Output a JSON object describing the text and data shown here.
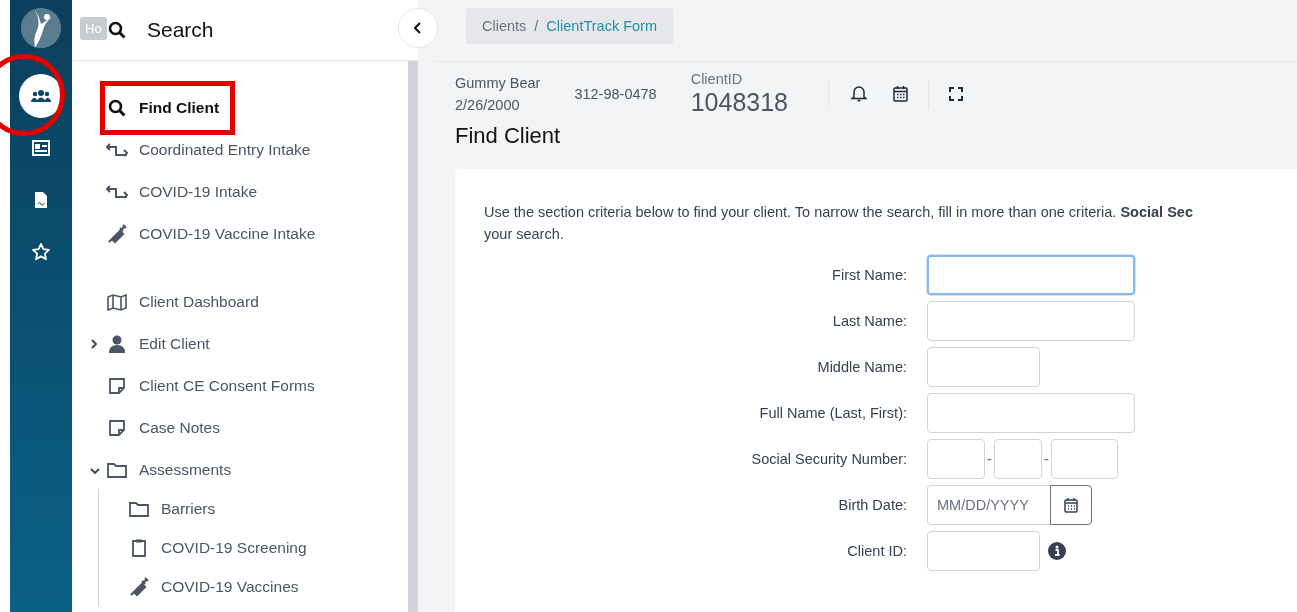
{
  "rail": {
    "tooltip": "Ho",
    "items": [
      {
        "kind": "people",
        "selected": true,
        "annotated": true
      },
      {
        "kind": "card",
        "selected": false,
        "annotated": false
      },
      {
        "kind": "document",
        "selected": false,
        "annotated": false
      },
      {
        "kind": "star",
        "selected": false,
        "annotated": false
      }
    ]
  },
  "sidebar": {
    "title": "Search",
    "sections": [
      {
        "items": [
          {
            "label": "Find Client",
            "kind": "search",
            "selected": true,
            "annotated": true
          },
          {
            "label": "Coordinated Entry Intake",
            "kind": "swap",
            "selected": false,
            "annotated": false
          },
          {
            "label": "COVID-19 Intake",
            "kind": "swap",
            "selected": false,
            "annotated": false
          },
          {
            "label": "COVID-19 Vaccine Intake",
            "kind": "syringe",
            "selected": false,
            "annotated": false
          }
        ]
      },
      {
        "items": [
          {
            "label": "Client Dashboard",
            "kind": "map",
            "selected": false,
            "annotated": false
          },
          {
            "label": "Edit Client",
            "kind": "person",
            "selected": false,
            "annotated": false,
            "expanded": false
          },
          {
            "label": "Client CE Consent Forms",
            "kind": "note",
            "selected": false,
            "annotated": false
          },
          {
            "label": "Case Notes",
            "kind": "note",
            "selected": false,
            "annotated": false
          },
          {
            "label": "Assessments",
            "kind": "folder",
            "selected": false,
            "annotated": false,
            "expanded": true,
            "children": [
              {
                "label": "Barriers",
                "kind": "folder",
                "selected": false,
                "annotated": false
              },
              {
                "label": "COVID-19 Screening",
                "kind": "clipboard",
                "selected": false,
                "annotated": false
              },
              {
                "label": "COVID-19 Vaccines",
                "kind": "syringe",
                "selected": false,
                "annotated": false
              }
            ]
          }
        ]
      }
    ]
  },
  "breadcrumb": {
    "items": [
      "Clients",
      "ClientTrack Form"
    ],
    "separator": "/"
  },
  "client": {
    "name": "Gummy Bear",
    "birth_date": "2/26/2000",
    "ssn": "312-98-0478",
    "id_label": "ClientID",
    "id": "1048318"
  },
  "page_title": "Find Client",
  "intro": [
    "Use the section criteria below to find your client. To narrow the search, fill in more than one criteria. **Social Sec**",
    "your search."
  ],
  "fields": [
    {
      "label": "First Name:",
      "kind": "wide",
      "focused": true
    },
    {
      "label": "Last Name:",
      "kind": "wide",
      "focused": false
    },
    {
      "label": "Middle Name:",
      "kind": "short",
      "focused": false
    },
    {
      "label": "Full Name (Last, First):",
      "kind": "wide",
      "focused": false
    },
    {
      "label": "Social Security Number:",
      "kind": "ssn",
      "focused": false,
      "separators": [
        "-",
        "-"
      ]
    },
    {
      "label": "Birth Date:",
      "kind": "date",
      "focused": false,
      "placeholder": "MM/DD/YYYY"
    },
    {
      "label": "Client ID:",
      "kind": "short",
      "focused": false,
      "info": true
    }
  ]
}
